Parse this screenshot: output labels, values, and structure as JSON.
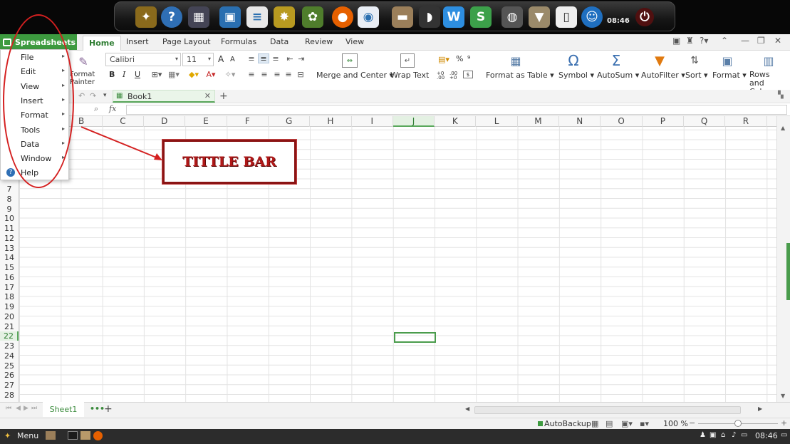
{
  "dock": {
    "time": "08:46"
  },
  "app": {
    "name": "Spreadsheets"
  },
  "tabs": [
    "Home",
    "Insert",
    "Page Layout",
    "Formulas",
    "Data",
    "Review",
    "View"
  ],
  "ribbon": {
    "format_painter": "Format Painter",
    "font_name": "Calibri",
    "font_size": "11",
    "grow_font": "A",
    "shrink_font": "A",
    "bold": "B",
    "italic": "I",
    "underline": "U",
    "merge_center": "Merge and Center",
    "wrap_text": "Wrap Text",
    "percent": "%",
    "comma": "⁹",
    "inc_decimal": "+0 .00",
    "dec_decimal": ".00 +0",
    "format_as_table": "Format as Table",
    "symbol": "Symbol",
    "autosum": "AutoSum",
    "autofilter": "AutoFilter",
    "sort": "Sort",
    "format": "Format",
    "rows_columns": "Rows and Columns"
  },
  "doc_tab": {
    "name": "Book1"
  },
  "formula_bar": {
    "fx": "fx",
    "value": ""
  },
  "columns": [
    "B",
    "C",
    "D",
    "E",
    "F",
    "G",
    "H",
    "I",
    "J",
    "K",
    "L",
    "M",
    "N",
    "O",
    "P",
    "Q",
    "R"
  ],
  "selected_column": "J",
  "rows": [
    "7",
    "8",
    "9",
    "10",
    "11",
    "12",
    "13",
    "14",
    "15",
    "16",
    "17",
    "18",
    "19",
    "20",
    "21",
    "22",
    "23",
    "24",
    "25",
    "26",
    "27",
    "28"
  ],
  "selected_row": "22",
  "menu_items": [
    {
      "label": "File",
      "submenu": true
    },
    {
      "label": "Edit",
      "submenu": true
    },
    {
      "label": "View",
      "submenu": true
    },
    {
      "label": "Insert",
      "submenu": true
    },
    {
      "label": "Format",
      "submenu": true
    },
    {
      "label": "Tools",
      "submenu": true
    },
    {
      "label": "Data",
      "submenu": true
    },
    {
      "label": "Window",
      "submenu": true
    },
    {
      "label": "Help",
      "submenu": false
    }
  ],
  "annotation": {
    "label": "TITTLE BAR"
  },
  "sheet_tab": {
    "name": "Sheet1",
    "more": "•••",
    "add": "+"
  },
  "status": {
    "autobackup": "AutoBackup",
    "zoom": "100 %"
  },
  "taskbar": {
    "menu_label": "Menu",
    "time": "08:46"
  },
  "colors": {
    "accent": "#3d9a3f",
    "annotation": "#b01818"
  }
}
